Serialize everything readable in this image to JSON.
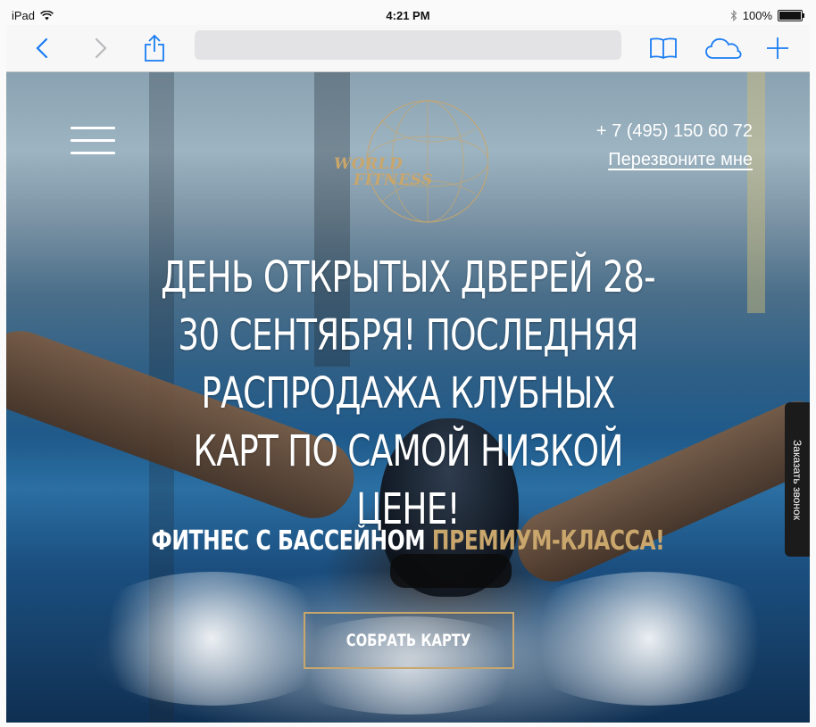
{
  "status_bar": {
    "device": "iPad",
    "time": "4:21 PM",
    "battery": "100%"
  },
  "toolbar": {
    "back_icon": "chevron-left-icon",
    "forward_icon": "chevron-right-icon",
    "share_icon": "share-icon",
    "bookmarks_icon": "book-icon",
    "cloud_icon": "cloud-icon",
    "new_tab_icon": "plus-icon",
    "url": "",
    "accent_color": "#1a7cf4"
  },
  "page": {
    "logo": {
      "line1": "WORLD",
      "line2": "FITNESS"
    },
    "phone": "+ 7 (495) 150 60 72",
    "callback_link": "Перезвоните мне",
    "headline": "День открытых дверей 28-30 сентября! Последняя распродажа клубных карт по самой низкой цене!",
    "subline_white": "Фитнес с бассейном ",
    "subline_gold": "премиум-класса!",
    "cta_label": "Собрать карту",
    "side_tab_label": "Заказать звонок",
    "gold_color": "#c9a66b"
  }
}
